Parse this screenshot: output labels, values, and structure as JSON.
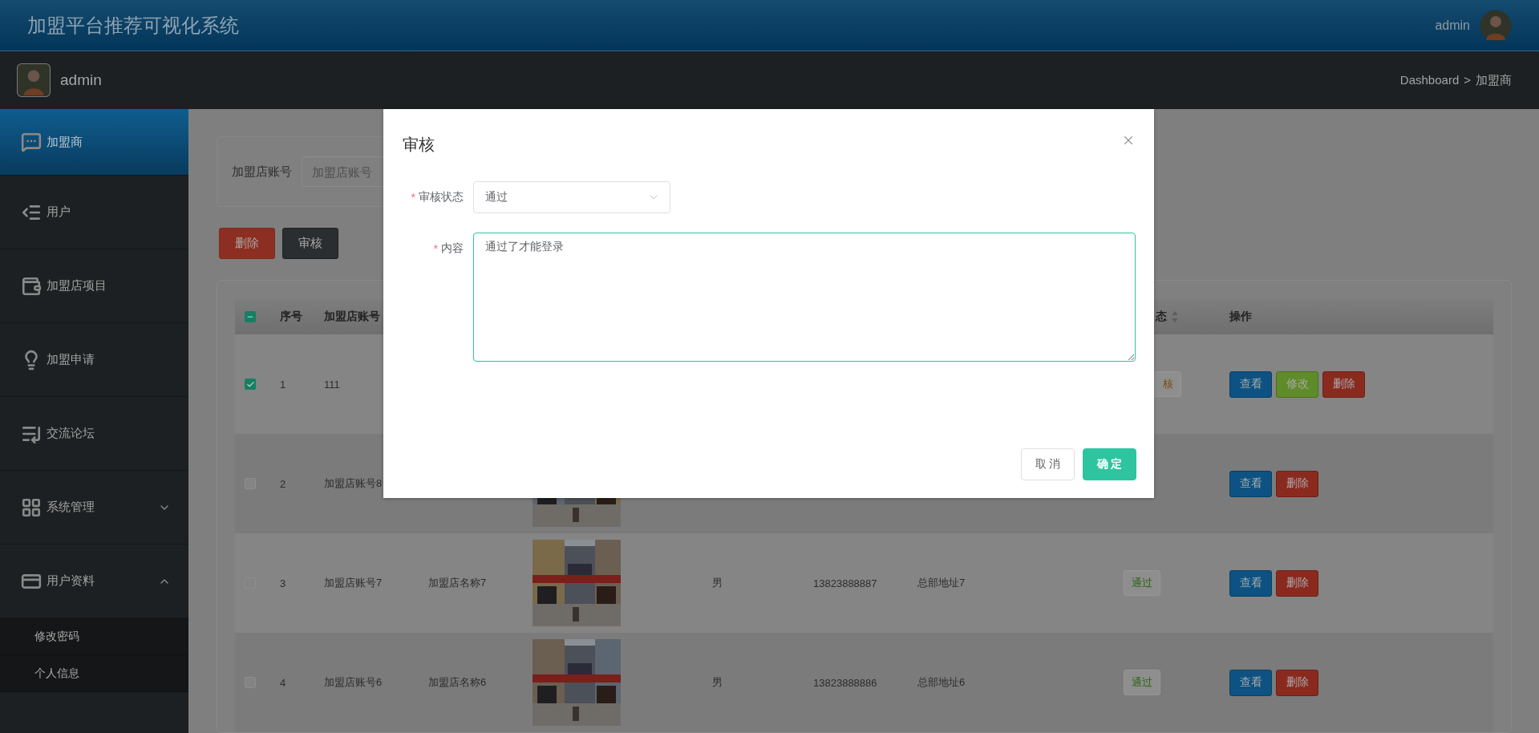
{
  "app_title": "加盟平台推荐可视化系统",
  "header_user": "admin",
  "profile": {
    "name": "admin"
  },
  "breadcrumb": {
    "items": [
      "Dashboard",
      "加盟商"
    ],
    "separator": ">"
  },
  "sidebar": {
    "items": [
      {
        "label": "加盟商",
        "selected": true
      },
      {
        "label": "用户",
        "selected": false
      },
      {
        "label": "加盟店项目",
        "selected": false
      },
      {
        "label": "加盟申请",
        "selected": false
      },
      {
        "label": "交流论坛",
        "selected": false
      },
      {
        "label": "系统管理",
        "selected": false,
        "expanded": false
      },
      {
        "label": "用户资料",
        "selected": false,
        "expanded": true,
        "children": [
          {
            "label": "修改密码",
            "selected": false
          },
          {
            "label": "个人信息",
            "selected": false
          }
        ]
      }
    ]
  },
  "search": {
    "label": "加盟店账号",
    "placeholder": "加盟店账号"
  },
  "actions": [
    {
      "label": "删除",
      "kind": "danger"
    },
    {
      "label": "审核",
      "kind": "dark"
    }
  ],
  "table": {
    "select_all": {
      "indeterminate": true
    },
    "columns": [
      {
        "kind": "index",
        "label": "序号"
      },
      {
        "kind": "account",
        "label": "加盟店账号"
      },
      {
        "kind": "status",
        "label": "态",
        "sortable": true,
        "partly_hidden": true
      },
      {
        "kind": "actions",
        "label": "操作"
      }
    ],
    "rows": [
      {
        "checked": true,
        "index": "1",
        "account": "111",
        "status": {
          "label": "核",
          "color": "#7a4a0c",
          "partly_hidden": true
        },
        "actions": [
          {
            "label": "查看",
            "kind": "view"
          },
          {
            "label": "修改",
            "kind": "edit"
          },
          {
            "label": "删除",
            "kind": "delete"
          }
        ]
      },
      {
        "checked": false,
        "index": "2",
        "account": "加盟店账号8",
        "image": {
          "kind": "picture"
        },
        "actions": [
          {
            "label": "查看",
            "kind": "view"
          },
          {
            "label": "删除",
            "kind": "delete"
          }
        ]
      },
      {
        "checked": false,
        "index": "3",
        "account": "加盟店账号7",
        "name": "加盟店名称7",
        "image": {
          "kind": "picture"
        },
        "gender": "男",
        "phone": "13823888887",
        "address": "总部地址7",
        "status": {
          "label": "通过",
          "color": "#2c6410",
          "partly_hidden": false
        },
        "actions": [
          {
            "label": "查看",
            "kind": "view"
          },
          {
            "label": "删除",
            "kind": "delete"
          }
        ]
      },
      {
        "checked": false,
        "index": "4",
        "account": "加盟店账号6",
        "name": "加盟店名称6",
        "image": {
          "kind": "picture"
        },
        "gender": "男",
        "phone": "13823888886",
        "address": "总部地址6",
        "status": {
          "label": "通过",
          "color": "#2c6410",
          "partly_hidden": false
        },
        "actions": [
          {
            "label": "查看",
            "kind": "view"
          },
          {
            "label": "删除",
            "kind": "delete"
          }
        ]
      }
    ]
  },
  "modal": {
    "title": "审核",
    "fields": [
      {
        "label": "审核状态",
        "required_mark": "*",
        "kind": "select",
        "value": "通过"
      },
      {
        "label": "内容",
        "required_mark": "*",
        "kind": "textarea",
        "value": "通过了才能登录"
      }
    ],
    "buttons": [
      {
        "label": "取 消",
        "kind": "default"
      },
      {
        "label": "确 定",
        "kind": "primary"
      }
    ]
  }
}
